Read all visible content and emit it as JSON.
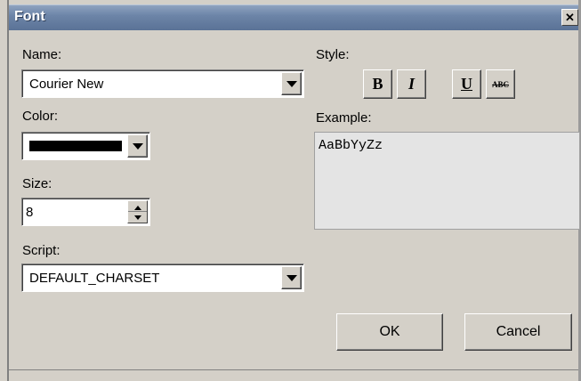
{
  "window": {
    "title": "Font",
    "close_glyph": "✕"
  },
  "name": {
    "label": "Name:",
    "value": "Courier New"
  },
  "color": {
    "label": "Color:",
    "value_color": "#000000"
  },
  "size": {
    "label": "Size:",
    "value": "8"
  },
  "script": {
    "label": "Script:",
    "value": "DEFAULT_CHARSET"
  },
  "style": {
    "label": "Style:",
    "buttons": [
      {
        "id": "bold",
        "text": "B"
      },
      {
        "id": "italic",
        "text": "I"
      },
      {
        "id": "underline",
        "text": "U"
      },
      {
        "id": "strikethrough",
        "text": "ABC"
      }
    ]
  },
  "example": {
    "label": "Example:",
    "text": "AaBbYyZz"
  },
  "buttons": {
    "ok": "OK",
    "cancel": "Cancel"
  },
  "colors": {
    "titlebar": "#6d85a8",
    "face": "#d4d0c8"
  }
}
